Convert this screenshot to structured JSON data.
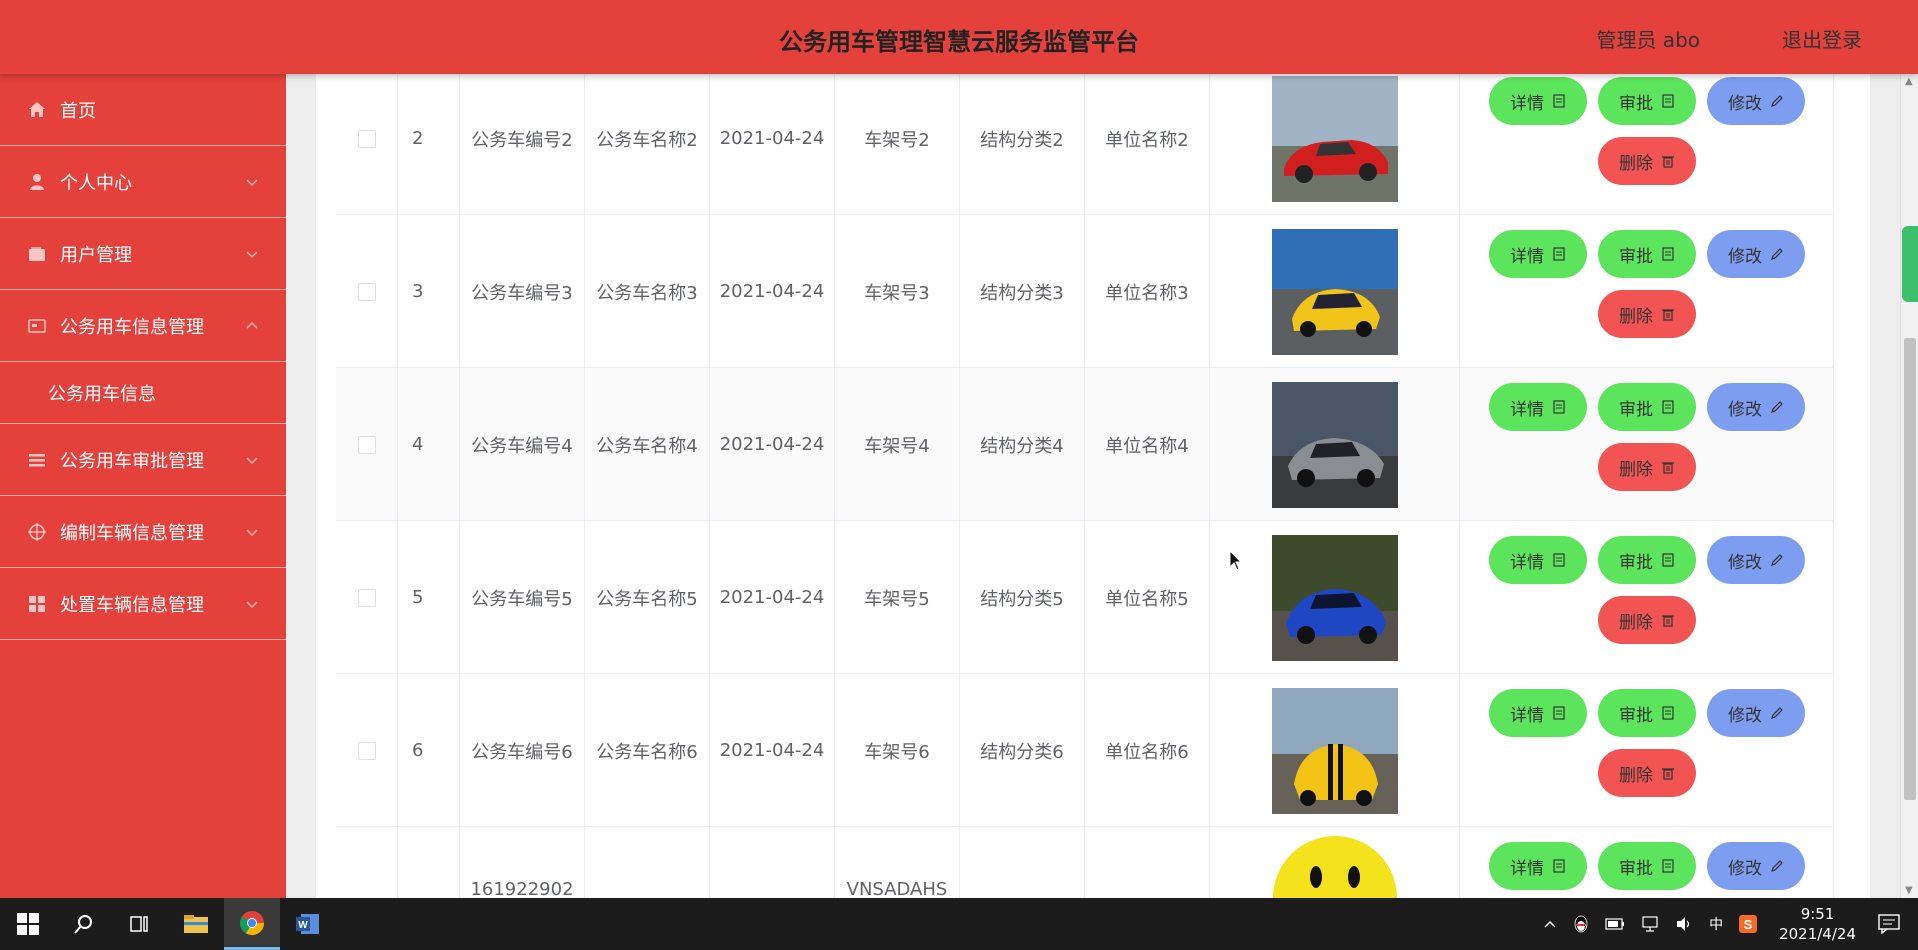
{
  "header": {
    "title": "公务用车管理智慧云服务监管平台",
    "user": "管理员 abo",
    "logout": "退出登录"
  },
  "sidebar": {
    "items": [
      {
        "label": "首页",
        "icon": "home-icon"
      },
      {
        "label": "个人中心",
        "icon": "user-icon"
      },
      {
        "label": "用户管理",
        "icon": "wallet-icon"
      },
      {
        "label": "公务用车信息管理",
        "icon": "card-icon"
      },
      {
        "label": "公务用车审批管理",
        "icon": "list-icon"
      },
      {
        "label": "编制车辆信息管理",
        "icon": "target-icon"
      },
      {
        "label": "处置车辆信息管理",
        "icon": "grid-icon"
      }
    ],
    "submenu_label": "公务用车信息"
  },
  "table": {
    "rows": [
      {
        "idx": "2",
        "code": "公务车编号2",
        "name": "公务车名称2",
        "date": "2021-04-24",
        "frame": "车架号2",
        "cls": "结构分类2",
        "unit": "单位名称2"
      },
      {
        "idx": "3",
        "code": "公务车编号3",
        "name": "公务车名称3",
        "date": "2021-04-24",
        "frame": "车架号3",
        "cls": "结构分类3",
        "unit": "单位名称3"
      },
      {
        "idx": "4",
        "code": "公务车编号4",
        "name": "公务车名称4",
        "date": "2021-04-24",
        "frame": "车架号4",
        "cls": "结构分类4",
        "unit": "单位名称4"
      },
      {
        "idx": "5",
        "code": "公务车编号5",
        "name": "公务车名称5",
        "date": "2021-04-24",
        "frame": "车架号5",
        "cls": "结构分类5",
        "unit": "单位名称5"
      },
      {
        "idx": "6",
        "code": "公务车编号6",
        "name": "公务车名称6",
        "date": "2021-04-24",
        "frame": "车架号6",
        "cls": "结构分类6",
        "unit": "单位名称6"
      },
      {
        "idx": "",
        "code": "161922902",
        "name": "",
        "date": "",
        "frame": "VNSADAHS",
        "cls": "",
        "unit": ""
      }
    ],
    "buttons": {
      "detail": "详情",
      "approve": "审批",
      "edit": "修改",
      "delete": "删除"
    }
  },
  "taskbar": {
    "time": "9:51",
    "date": "2021/4/24",
    "ime": "中"
  },
  "colors": {
    "brand": "#e4413c",
    "btn_green": "#5ce55c",
    "btn_blue": "#7d9ef0",
    "btn_red": "#f25454"
  }
}
